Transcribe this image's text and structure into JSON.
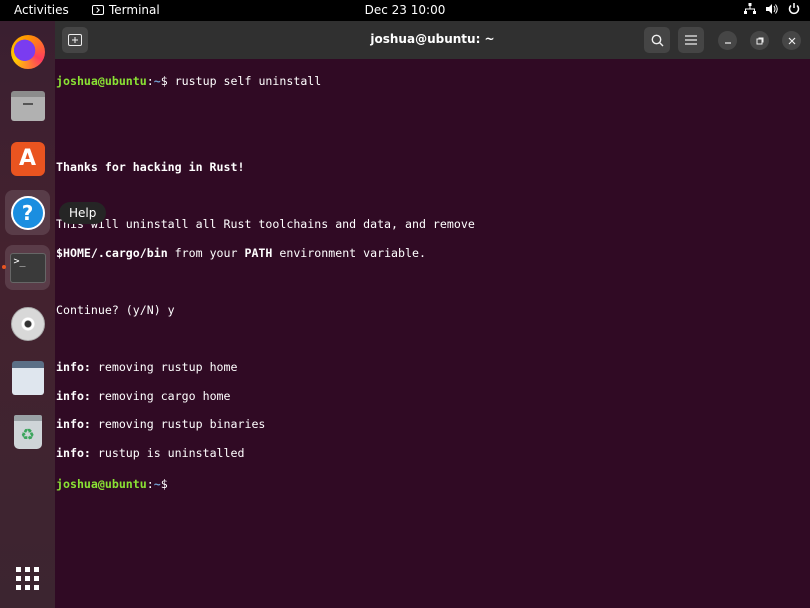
{
  "topbar": {
    "activities": "Activities",
    "app_name": "Terminal",
    "clock": "Dec 23  10:00",
    "tray_icons": [
      "network-icon",
      "volume-icon",
      "power-icon"
    ]
  },
  "dock": {
    "items": [
      "firefox-icon",
      "files-icon",
      "app-center-icon",
      "help-icon",
      "terminal-icon",
      "disc-icon",
      "text-editor-icon",
      "trash-icon"
    ],
    "tooltip": "Help",
    "terminal_glyph": ">_",
    "trash_glyph": "♻",
    "help_glyph": "?",
    "appstore_glyph": "A"
  },
  "window": {
    "title": "joshua@ubuntu: ~"
  },
  "terminal": {
    "prompt_user": "joshua@ubuntu",
    "prompt_sep": ":",
    "prompt_path": "~",
    "prompt_symbol": "$ ",
    "command": "rustup self uninstall",
    "line_thanks": "Thanks for hacking in Rust!",
    "line_warn1": "This will uninstall all Rust toolchains and data, and remove",
    "warn2_a": "$HOME/.cargo/bin",
    "warn2_b": " from your ",
    "warn2_c": "PATH",
    "warn2_d": " environment variable.",
    "continue_prompt": "Continue? (y/N) y",
    "info_label": "info:",
    "info_lines": [
      " removing rustup home",
      " removing cargo home",
      " removing rustup binaries",
      " rustup is uninstalled"
    ]
  },
  "colors": {
    "terminal_bg": "#300a24",
    "prompt_green": "#8ae234",
    "path_blue": "#729fcf",
    "accent": "#e95420"
  }
}
